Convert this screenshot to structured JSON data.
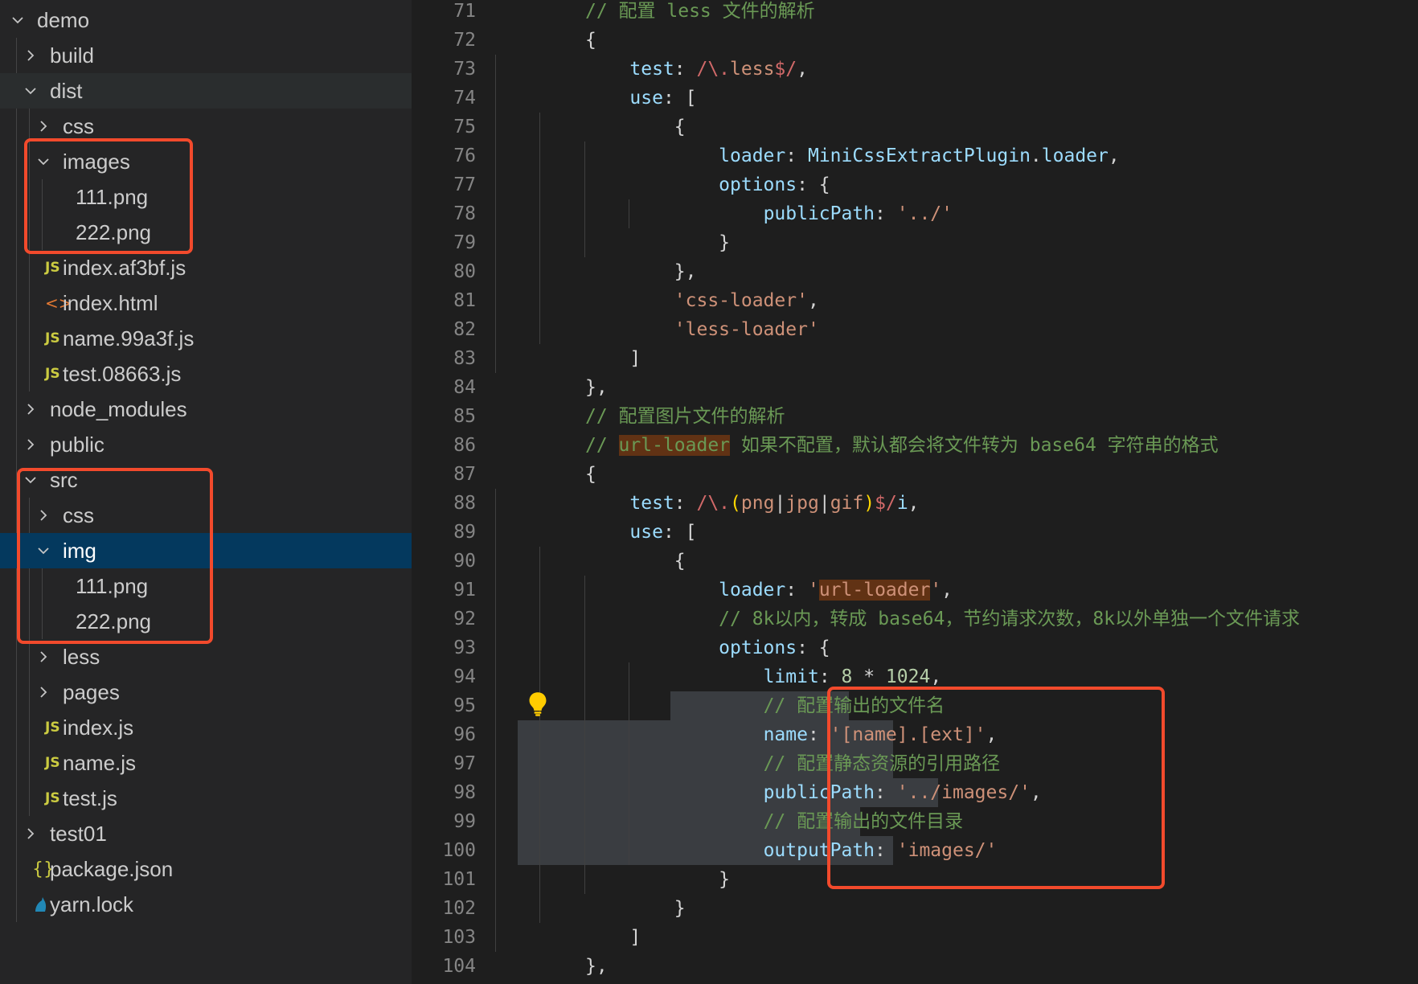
{
  "explorer": {
    "items": [
      {
        "label": "demo",
        "kind": "folder-open"
      },
      {
        "label": "build",
        "kind": "folder"
      },
      {
        "label": "dist",
        "kind": "folder-open"
      },
      {
        "label": "css",
        "kind": "folder"
      },
      {
        "label": "images",
        "kind": "folder-open"
      },
      {
        "label": "111.png",
        "kind": "image"
      },
      {
        "label": "222.png",
        "kind": "image"
      },
      {
        "label": "index.af3bf.js",
        "kind": "js"
      },
      {
        "label": "index.html",
        "kind": "html"
      },
      {
        "label": "name.99a3f.js",
        "kind": "js"
      },
      {
        "label": "test.08663.js",
        "kind": "js"
      },
      {
        "label": "node_modules",
        "kind": "folder"
      },
      {
        "label": "public",
        "kind": "folder"
      },
      {
        "label": "src",
        "kind": "folder-open"
      },
      {
        "label": "css",
        "kind": "folder"
      },
      {
        "label": "img",
        "kind": "folder-open",
        "selected": true
      },
      {
        "label": "111.png",
        "kind": "image"
      },
      {
        "label": "222.png",
        "kind": "image"
      },
      {
        "label": "less",
        "kind": "folder"
      },
      {
        "label": "pages",
        "kind": "folder"
      },
      {
        "label": "index.js",
        "kind": "js"
      },
      {
        "label": "name.js",
        "kind": "js"
      },
      {
        "label": "test.js",
        "kind": "js"
      },
      {
        "label": "test01",
        "kind": "folder"
      },
      {
        "label": "package.json",
        "kind": "json"
      },
      {
        "label": "yarn.lock",
        "kind": "yarn"
      }
    ],
    "icon_glyphs": {
      "js": "JS",
      "html": "<>",
      "json": "{}"
    }
  },
  "editor": {
    "lines": [
      {
        "n": "71",
        "t": [
          [
            "c",
            "// 配置 less 文件的解析"
          ]
        ]
      },
      {
        "n": "72",
        "t": [
          [
            "p",
            "{"
          ]
        ]
      },
      {
        "n": "73",
        "t": [
          [
            "p",
            "    "
          ],
          [
            "k",
            "test"
          ],
          [
            "p",
            ": "
          ],
          [
            "r",
            "/\\."
          ],
          [
            "s",
            "less"
          ],
          [
            "r",
            "$/"
          ],
          [
            "p",
            ","
          ]
        ]
      },
      {
        "n": "74",
        "t": [
          [
            "p",
            "    "
          ],
          [
            "k",
            "use"
          ],
          [
            "p",
            ": ["
          ]
        ]
      },
      {
        "n": "75",
        "t": [
          [
            "p",
            "        {"
          ]
        ]
      },
      {
        "n": "76",
        "t": [
          [
            "p",
            "            "
          ],
          [
            "k",
            "loader"
          ],
          [
            "p",
            ": "
          ],
          [
            "k",
            "MiniCssExtractPlugin"
          ],
          [
            "p",
            "."
          ],
          [
            "k",
            "loader"
          ],
          [
            "p",
            ","
          ]
        ]
      },
      {
        "n": "77",
        "t": [
          [
            "p",
            "            "
          ],
          [
            "k",
            "options"
          ],
          [
            "p",
            ": {"
          ]
        ]
      },
      {
        "n": "78",
        "t": [
          [
            "p",
            "                "
          ],
          [
            "k",
            "publicPath"
          ],
          [
            "p",
            ": "
          ],
          [
            "s",
            "'../'"
          ]
        ]
      },
      {
        "n": "79",
        "t": [
          [
            "p",
            "            }"
          ]
        ]
      },
      {
        "n": "80",
        "t": [
          [
            "p",
            "        },"
          ]
        ]
      },
      {
        "n": "81",
        "t": [
          [
            "p",
            "        "
          ],
          [
            "s",
            "'css-loader'"
          ],
          [
            "p",
            ","
          ]
        ]
      },
      {
        "n": "82",
        "t": [
          [
            "p",
            "        "
          ],
          [
            "s",
            "'less-loader'"
          ]
        ]
      },
      {
        "n": "83",
        "t": [
          [
            "p",
            "    ]"
          ]
        ]
      },
      {
        "n": "84",
        "t": [
          [
            "p",
            "},"
          ]
        ]
      },
      {
        "n": "85",
        "t": [
          [
            "c",
            "// 配置图片文件的解析"
          ]
        ]
      },
      {
        "n": "86",
        "t": [
          [
            "c",
            "// "
          ],
          [
            "ch",
            "url-loader"
          ],
          [
            "c",
            " 如果不配置，默认都会将文件转为 base64 字符串的格式"
          ]
        ]
      },
      {
        "n": "87",
        "t": [
          [
            "p",
            "{"
          ]
        ]
      },
      {
        "n": "88",
        "t": [
          [
            "p",
            "    "
          ],
          [
            "k",
            "test"
          ],
          [
            "p",
            ": "
          ],
          [
            "r",
            "/\\."
          ],
          [
            "y",
            "("
          ],
          [
            "s",
            "png"
          ],
          [
            "p",
            "|"
          ],
          [
            "s",
            "jpg"
          ],
          [
            "p",
            "|"
          ],
          [
            "s",
            "gif"
          ],
          [
            "y",
            ")"
          ],
          [
            "r",
            "$/"
          ],
          [
            "k",
            "i"
          ],
          [
            "p",
            ","
          ]
        ]
      },
      {
        "n": "89",
        "t": [
          [
            "p",
            "    "
          ],
          [
            "k",
            "use"
          ],
          [
            "p",
            ": ["
          ]
        ]
      },
      {
        "n": "90",
        "t": [
          [
            "p",
            "        {"
          ]
        ]
      },
      {
        "n": "91",
        "t": [
          [
            "p",
            "            "
          ],
          [
            "k",
            "loader"
          ],
          [
            "p",
            ": "
          ],
          [
            "s",
            "'"
          ],
          [
            "sh",
            "url-loader"
          ],
          [
            "s",
            "'"
          ],
          [
            "p",
            ","
          ]
        ]
      },
      {
        "n": "92",
        "t": [
          [
            "p",
            "            "
          ],
          [
            "c",
            "// 8k以内，转成 base64，节约请求次数，8k以外单独一个文件请求"
          ]
        ]
      },
      {
        "n": "93",
        "t": [
          [
            "p",
            "            "
          ],
          [
            "k",
            "options"
          ],
          [
            "p",
            ": {"
          ]
        ]
      },
      {
        "n": "94",
        "t": [
          [
            "p",
            "                "
          ],
          [
            "k",
            "limit"
          ],
          [
            "p",
            ": "
          ],
          [
            "n",
            "8"
          ],
          [
            "p",
            " * "
          ],
          [
            "n",
            "1024"
          ],
          [
            "p",
            ","
          ]
        ]
      },
      {
        "n": "95",
        "t": [
          [
            "p",
            "                "
          ],
          [
            "c",
            "// 配置输出的文件名"
          ]
        ]
      },
      {
        "n": "96",
        "t": [
          [
            "p",
            "                "
          ],
          [
            "k",
            "name"
          ],
          [
            "p",
            ": "
          ],
          [
            "s",
            "'[name].[ext]'"
          ],
          [
            "p",
            ","
          ]
        ]
      },
      {
        "n": "97",
        "t": [
          [
            "p",
            "                "
          ],
          [
            "c",
            "// 配置静态资源的引用路径"
          ]
        ]
      },
      {
        "n": "98",
        "t": [
          [
            "p",
            "                "
          ],
          [
            "k",
            "publicPath"
          ],
          [
            "p",
            ": "
          ],
          [
            "s",
            "'../images/'"
          ],
          [
            "p",
            ","
          ]
        ]
      },
      {
        "n": "99",
        "t": [
          [
            "p",
            "                "
          ],
          [
            "c",
            "// 配置输出的文件目录"
          ]
        ]
      },
      {
        "n": "100",
        "t": [
          [
            "p",
            "                "
          ],
          [
            "k",
            "outputPath"
          ],
          [
            "p",
            ": "
          ],
          [
            "s",
            "'images/'"
          ]
        ]
      },
      {
        "n": "101",
        "t": [
          [
            "p",
            "            }"
          ]
        ]
      },
      {
        "n": "102",
        "t": [
          [
            "p",
            "        }"
          ]
        ]
      },
      {
        "n": "103",
        "t": [
          [
            "p",
            "    ]"
          ]
        ]
      },
      {
        "n": "104",
        "t": [
          [
            "p",
            "},"
          ]
        ]
      }
    ]
  },
  "colors": {
    "editor_bg": "#1e1e1e",
    "sidebar_bg": "#252526",
    "selection_bg": "#04395e",
    "annotation_red": "#f24a2c",
    "lightbulb": "#ffcc00"
  }
}
